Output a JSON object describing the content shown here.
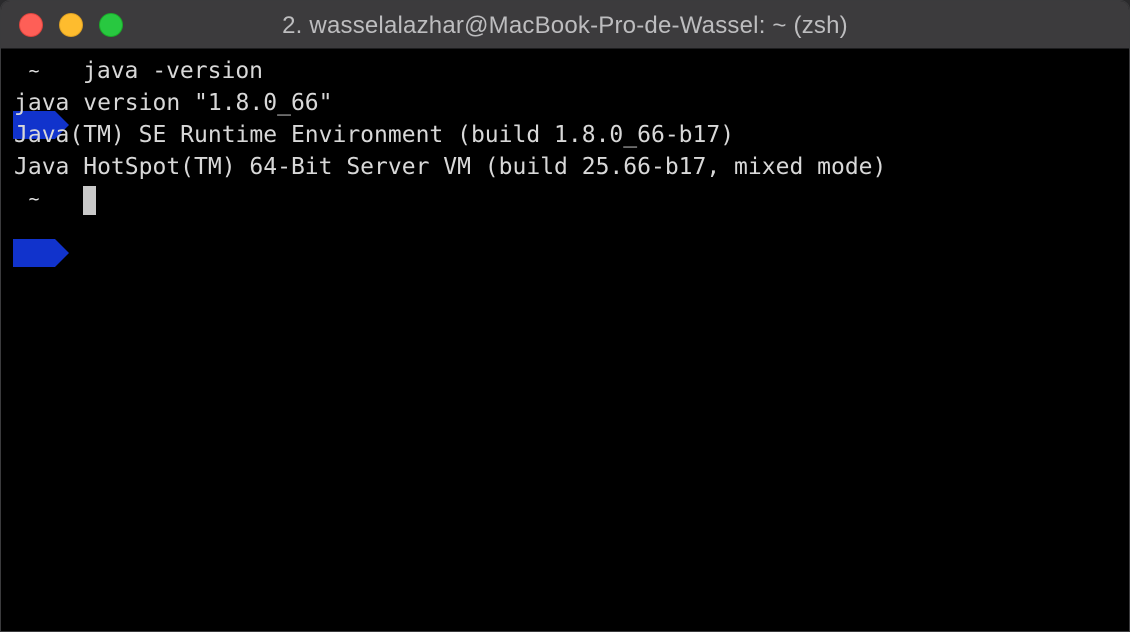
{
  "window": {
    "title": "2. wasselalazhar@MacBook-Pro-de-Wassel: ~ (zsh)"
  },
  "colors": {
    "prompt_bg": "#1133cc",
    "terminal_bg": "#000000",
    "text": "#d8d8d8",
    "close": "#fe5f57",
    "minimize": "#febc2e",
    "zoom": "#28c840"
  },
  "terminal": {
    "prompt_symbol": "~",
    "command": "java -version",
    "output": [
      "java version \"1.8.0_66\"",
      "Java(TM) SE Runtime Environment (build 1.8.0_66-b17)",
      "Java HotSpot(TM) 64-Bit Server VM (build 25.66-b17, mixed mode)"
    ],
    "second_prompt_symbol": "~"
  }
}
